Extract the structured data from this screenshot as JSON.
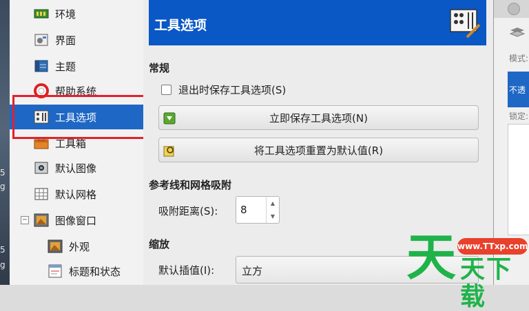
{
  "desktop": {
    "fragments": [
      "5",
      "g",
      "5",
      "g"
    ]
  },
  "sidebar": {
    "items": [
      {
        "label": "环境",
        "icon": "environment-icon"
      },
      {
        "label": "界面",
        "icon": "interface-icon"
      },
      {
        "label": "主题",
        "icon": "theme-icon"
      },
      {
        "label": "帮助系统",
        "icon": "help-system-icon"
      },
      {
        "label": "工具选项",
        "icon": "tool-options-icon",
        "selected": true
      },
      {
        "label": "工具箱",
        "icon": "toolbox-icon"
      },
      {
        "label": "默认图像",
        "icon": "default-image-icon"
      },
      {
        "label": "默认网格",
        "icon": "default-grid-icon"
      },
      {
        "label": "图像窗口",
        "icon": "image-window-icon",
        "expanded": true
      },
      {
        "label": "外观",
        "icon": "appearance-icon"
      },
      {
        "label": "标题和状态",
        "icon": "title-status-icon"
      }
    ],
    "tree_toggle": "−"
  },
  "header": {
    "title": "工具选项",
    "icon": "tool-options-large-icon"
  },
  "general": {
    "title": "常规",
    "save_on_exit_label": "退出时保存工具选项(S)",
    "save_on_exit_checked": false,
    "save_now_label": "立即保存工具选项(N)",
    "reset_label": "将工具选项重置为默认值(R)"
  },
  "snapping": {
    "title": "参考线和网格吸附",
    "distance_label": "吸附距离(S):",
    "distance_value": "8",
    "spin_up": "▲",
    "spin_down": "▼"
  },
  "scaling": {
    "title": "缩放",
    "interp_label": "默认插值(I):",
    "interp_value": "立方"
  },
  "right_window": {
    "mode_label": "模式:",
    "opacity_text": "不透",
    "lock_label": "锁定:"
  },
  "watermark": {
    "url": "www.TTxp.com",
    "big": "天",
    "small": "天下载"
  },
  "colors": {
    "accent": "#1f67c4",
    "header": "#0a57c6",
    "highlight": "#e4202b",
    "watermark_green": "#1fb34a"
  }
}
